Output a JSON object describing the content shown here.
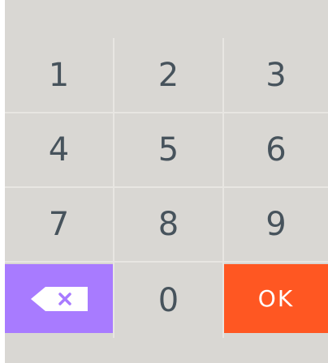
{
  "keypad": {
    "keys": [
      {
        "label": "1"
      },
      {
        "label": "2"
      },
      {
        "label": "3"
      },
      {
        "label": "4"
      },
      {
        "label": "5"
      },
      {
        "label": "6"
      },
      {
        "label": "7"
      },
      {
        "label": "8"
      },
      {
        "label": "9"
      },
      {
        "label": ""
      },
      {
        "label": "0"
      },
      {
        "label": "OK"
      }
    ],
    "backspace_icon": "backspace-icon",
    "colors": {
      "key_background": "#d9d7d3",
      "digit_text": "#47535c",
      "backspace": "#a87bff",
      "ok": "#ff5722",
      "ok_text": "#ffffff"
    }
  }
}
